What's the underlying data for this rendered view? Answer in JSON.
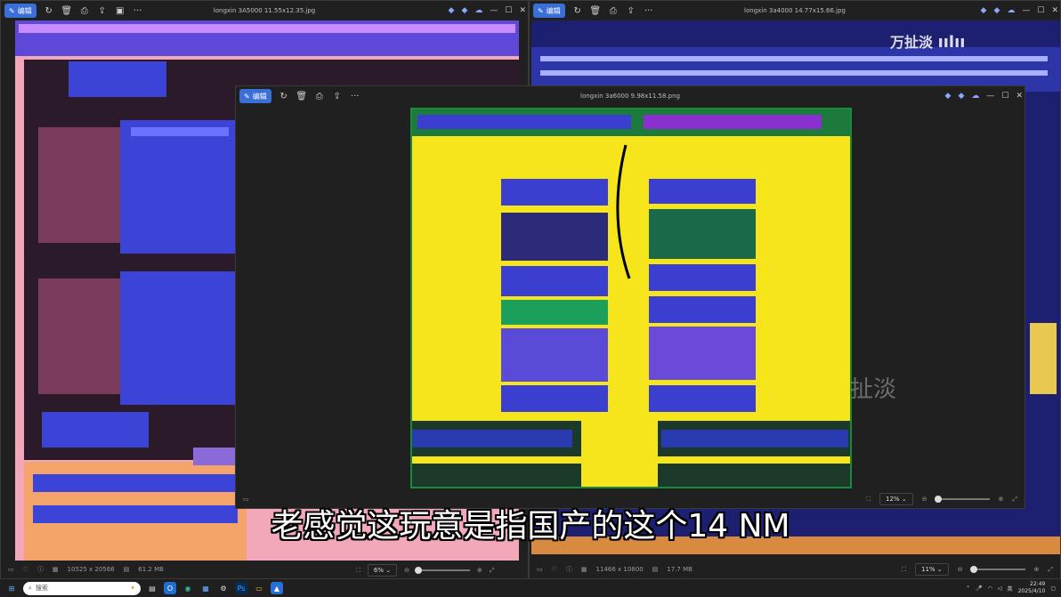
{
  "left_window": {
    "edit_label": "编辑",
    "title": "longxin 3A5000 11.55x12.35.jpg",
    "footer": {
      "dimensions": "10525 x 20566",
      "size": "61.2 MB",
      "zoom": "6%"
    }
  },
  "right_window": {
    "edit_label": "编辑",
    "title": "longxin 3a4000 14.77x15.66.jpg",
    "footer": {
      "dimensions": "11466 x 10800",
      "size": "17.7 MB",
      "zoom": "11%"
    }
  },
  "center_window": {
    "edit_label": "编辑",
    "title": "longxin 3a6000 9.98x11.58.png",
    "footer": {
      "zoom": "12%"
    }
  },
  "subtitle": "老感觉这玩意是指国产的这个14 NM",
  "watermark": "万扯淡",
  "watermark_center": "扯淡",
  "taskbar": {
    "search_placeholder": "搜索",
    "lang": "英",
    "time": "22:49",
    "date": "2025/4/10"
  },
  "colors": {
    "accent": "#3a6fd8",
    "chip_yellow": "#f6e51a",
    "chip_blue": "#3b3fd0"
  }
}
